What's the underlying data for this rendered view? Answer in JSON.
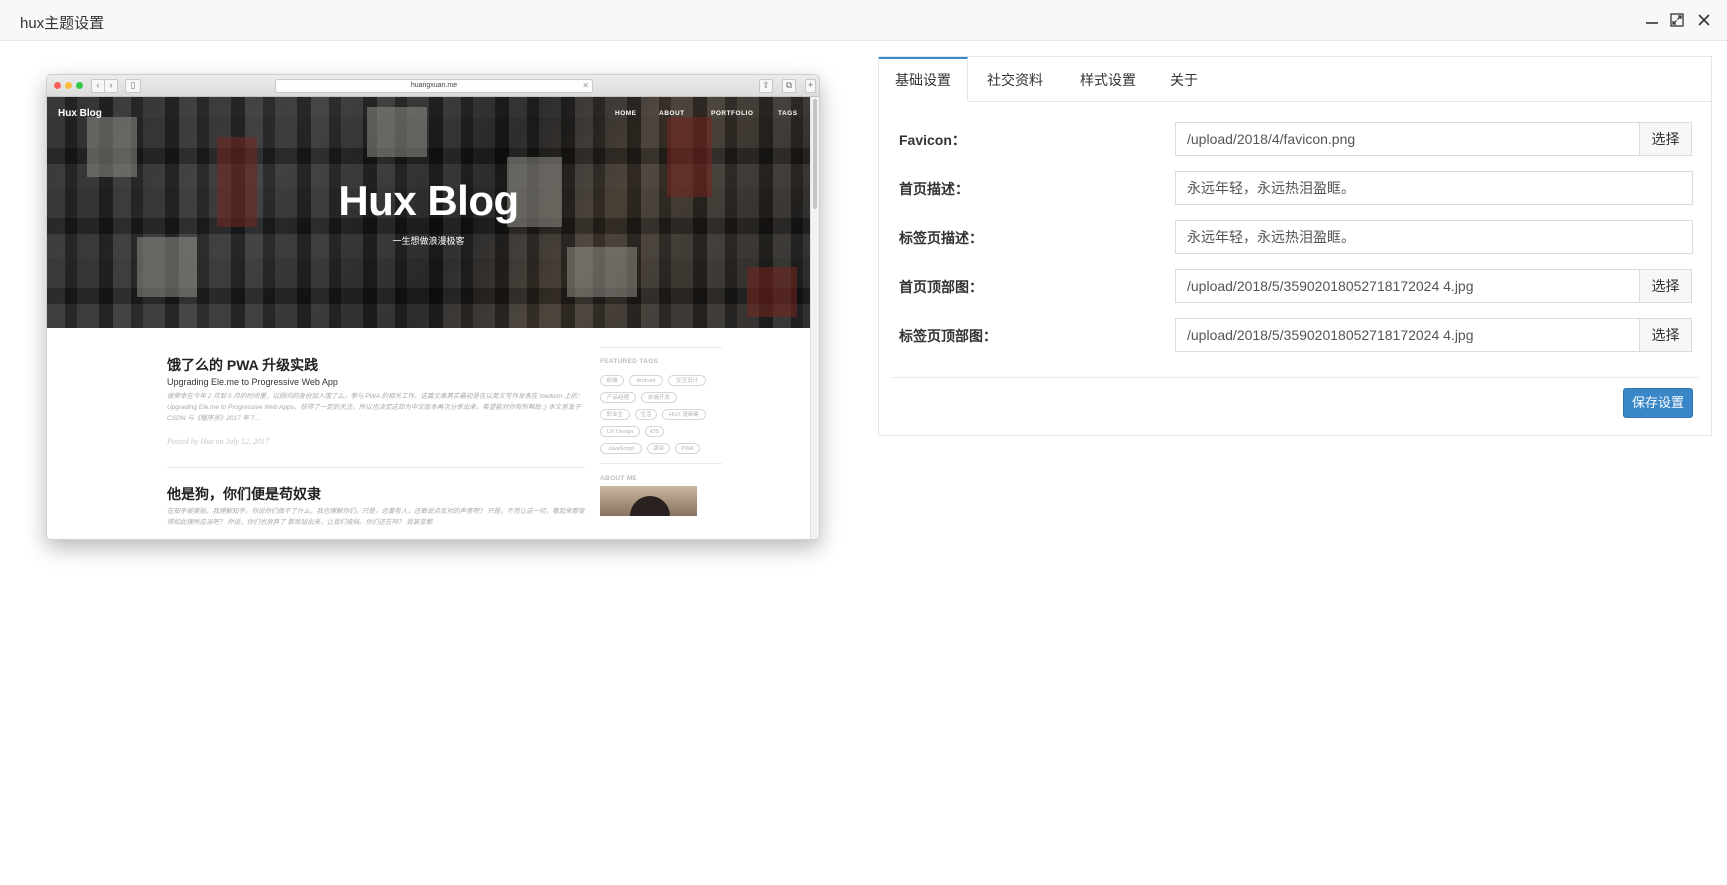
{
  "window": {
    "title": "hux主题设置"
  },
  "preview": {
    "url": "huangxuan.me",
    "blog": {
      "brand": "Hux Blog",
      "nav": [
        "HOME",
        "ABOUT",
        "PORTFOLIO",
        "TAGS"
      ],
      "hero_title": "Hux Blog",
      "hero_subtitle": "一生想做浪漫极客",
      "posts": [
        {
          "title": "饿了么的 PWA 升级实践",
          "subtitle": "Upgrading Ele.me to Progressive Web App",
          "excerpt": "很荣幸在今年 2 月到 5 月的时间里，以顾问的身份加入饿了么，参与 PWA 的相关工作。这篇文章其实最初是在以英文写作发表在 medium 上的：Upgrading Ele.me to Progressive Web Apps，获得了一定的关注。所以也决定这却为中文版本再次分享出来，希望能对你有所帮助 ;) 本文首发于 CSDN 与《程序员》2017 年 7...",
          "meta": "Posted by Hux on July 12, 2017"
        },
        {
          "title": "他是狗，你们便是苟奴隶",
          "subtitle": "",
          "excerpt": "在知乎被撕贴，我理解知乎。你说你们做不了什么，我也理解你们。只是，总要有人，还敢说点反对的声音吧？ 只是，不然让这一切，看起来都变得如此理所应当吧？ 你说，你们也放弃了 那就站出来，让我们被挡。你们还在吗？ 我甚至都",
          "meta": ""
        }
      ],
      "featured_tags_heading": "FEATURED TAGS",
      "tags": [
        "前端",
        "Android",
        "交互设计",
        "产品经理",
        "前端开发",
        "职业生",
        "生活",
        "HUX 漫画集",
        "UX Design",
        "iOS",
        "JavaScript",
        "演讲",
        "PWA"
      ],
      "about_heading": "ABOUT ME"
    }
  },
  "settings": {
    "tabs": [
      "基础设置",
      "社交资料",
      "样式设置",
      "关于"
    ],
    "active_tab": 0,
    "fields": [
      {
        "label": "Favicon：",
        "value": "/upload/2018/4/favicon.png",
        "has_picker": true
      },
      {
        "label": "首页描述：",
        "value": "永远年轻，永远热泪盈眶。",
        "has_picker": false
      },
      {
        "label": "标签页描述：",
        "value": "永远年轻，永远热泪盈眶。",
        "has_picker": false
      },
      {
        "label": "首页顶部图：",
        "value": "/upload/2018/5/35902018052718172024 4.jpg",
        "has_picker": true
      },
      {
        "label": "标签页顶部图：",
        "value": "/upload/2018/5/35902018052718172024 4.jpg",
        "has_picker": true
      }
    ],
    "picker_label": "选择",
    "save_label": "保存设置",
    "accent_color": "#3a87c8"
  }
}
